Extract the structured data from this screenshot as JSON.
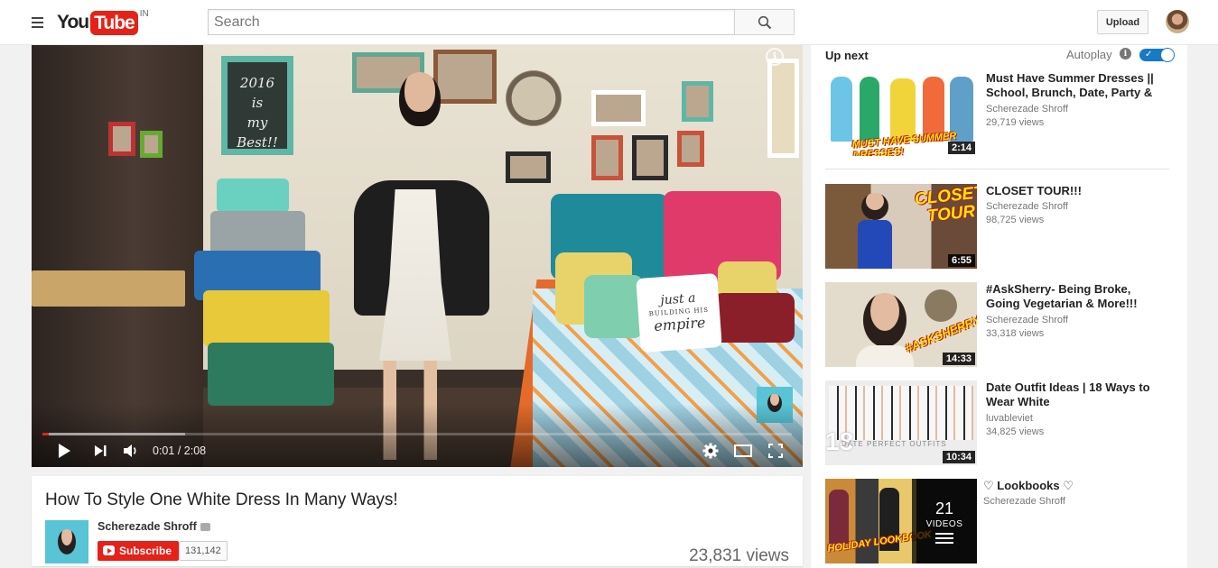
{
  "masthead": {
    "logo_you": "You",
    "logo_tube": "Tube",
    "logo_country": "IN",
    "search_placeholder": "Search",
    "upload_label": "Upload"
  },
  "player": {
    "wall_text_line1": "2016",
    "wall_text_line2": "is",
    "wall_text_line3": "my",
    "wall_text_line4": "Best!!",
    "pillow_line1": "just a",
    "pillow_line2": "BUILDING HIS",
    "pillow_line3": "empire",
    "info_glyph": "i",
    "current_time": "0:01",
    "time_separator": " / ",
    "duration": "2:08",
    "progress_played_fraction": 0.008,
    "progress_loaded_fraction": 0.19
  },
  "video": {
    "title": "How To Style One White Dress In Many Ways!",
    "channel_name": "Scherezade Shroff",
    "subscribe_label": "Subscribe",
    "subscriber_count": "131,142",
    "view_count": "23,831 views"
  },
  "sidebar": {
    "up_next_label": "Up next",
    "autoplay_label": "Autoplay",
    "autoplay_on": true,
    "recommendations": [
      {
        "title": "Must Have Summer Dresses || School, Brunch, Date, Party &",
        "channel": "Scherezade Shroff",
        "views": "29,719 views",
        "duration": "2:14",
        "thumb_caption": "MUST HAVE SUMMER DRESSES!"
      },
      {
        "title": "CLOSET TOUR!!!",
        "channel": "Scherezade Shroff",
        "views": "98,725 views",
        "duration": "6:55",
        "thumb_caption_line1": "CLOSET",
        "thumb_caption_line2": "TOUR"
      },
      {
        "title": "#AskSherry- Being Broke, Going Vegetarian & More!!!",
        "channel": "Scherezade Shroff",
        "views": "33,318 views",
        "duration": "14:33",
        "thumb_caption": "#ASKSHERRY"
      },
      {
        "title": "Date Outfit Ideas | 18 Ways to Wear White",
        "channel": "luvableviet",
        "views": "34,825 views",
        "duration": "10:34",
        "thumb_number": "18",
        "thumb_caption": "DATE PERFECT OUTFITS"
      },
      {
        "title": "♡ Lookbooks ♡",
        "channel": "Scherezade Shroff",
        "playlist_count": "21",
        "playlist_label": "VIDEOS",
        "thumb_caption": "HOLIDAY LOOKBOOK"
      }
    ]
  }
}
